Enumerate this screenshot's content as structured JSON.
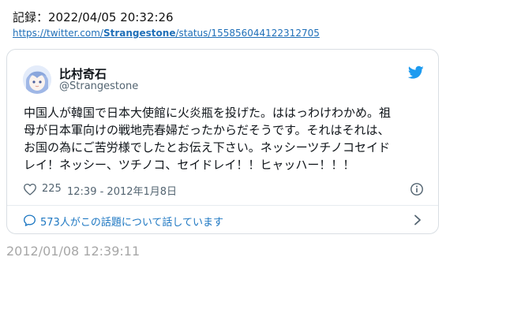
{
  "record": {
    "text": "記録：2022/04/05 20:32:26"
  },
  "link": {
    "prefix": "https://twitter.com/",
    "user": "Strangestone",
    "suffix": "/status/155856044122312705"
  },
  "tweet": {
    "display_name": "比村奇石",
    "handle": "@Strangestone",
    "text_lines": [
      "中国人が韓国で日本大使館に火炎瓶を投げた。ははっわけわかめ。祖",
      "母が日本軍向けの戦地売春婦だったからだそうです。それはそれは、",
      "お国の為にご苦労様でしたとお伝え下さい。ネッシーツチノコセイド",
      "レイ！ネッシー、ツチノコ、セイドレイ！！ヒャッハー！！！"
    ],
    "like_count": "225",
    "timestamp": "12:39 - 2012年1月8日",
    "conversation_label": "573人がこの話題について話しています"
  },
  "archive": {
    "time": "2012/01/08 12:39:11"
  },
  "colors": {
    "link": "#1f6fb8",
    "accent": "#1d9bf0",
    "muted": "#536471",
    "archive_time": "#a7a7a7"
  },
  "icons": {
    "avatar": "avatar",
    "brand": "twitter-bird-icon",
    "like": "heart-icon",
    "info": "info-icon",
    "reply": "reply-icon",
    "more": "chevron-right-icon"
  }
}
